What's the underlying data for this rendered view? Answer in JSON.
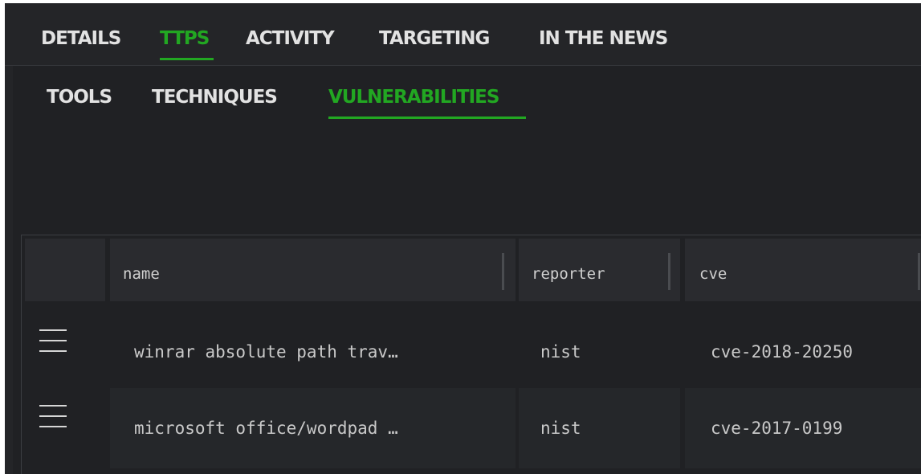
{
  "main_tabs": [
    {
      "label": "DETAILS",
      "active": false
    },
    {
      "label": "TTPS",
      "active": true
    },
    {
      "label": "ACTIVITY",
      "active": false
    },
    {
      "label": "TARGETING",
      "active": false
    },
    {
      "label": "IN THE NEWS",
      "active": false
    }
  ],
  "sub_tabs": [
    {
      "label": "TOOLS",
      "active": false
    },
    {
      "label": "TECHNIQUES",
      "active": false
    },
    {
      "label": "VULNERABILITIES",
      "active": true
    }
  ],
  "table": {
    "columns": [
      "name",
      "reporter",
      "cve"
    ],
    "rows": [
      {
        "name": "winrar absolute path trav…",
        "reporter": "nist",
        "cve": "cve-2018-20250"
      },
      {
        "name": "microsoft office/wordpad …",
        "reporter": "nist",
        "cve": "cve-2017-0199"
      }
    ]
  },
  "colors": {
    "accent": "#22a722",
    "background": "#242528",
    "panel": "#202124",
    "header": "#2a2b2f",
    "alt_row": "#25272a"
  },
  "icons": {
    "row_handle": "drag-handle-icon"
  }
}
